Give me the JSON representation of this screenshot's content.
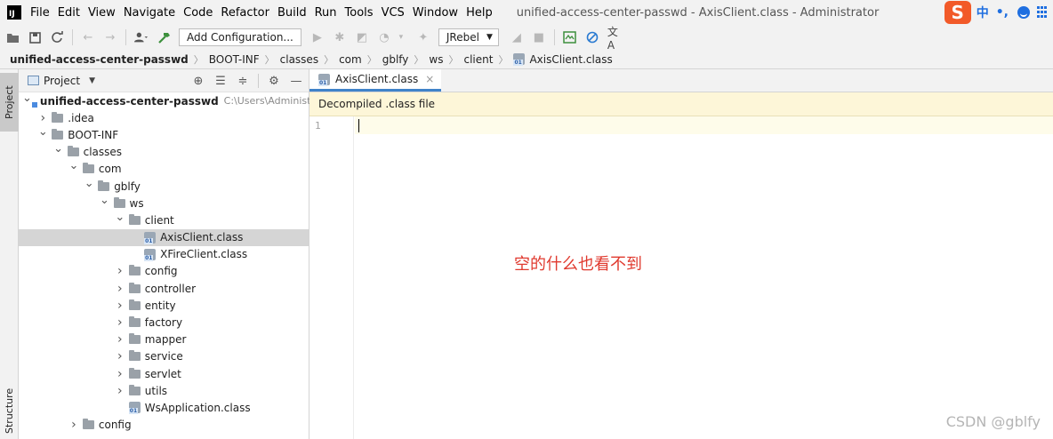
{
  "menubar": {
    "logo_text": "IJ",
    "items": [
      "File",
      "Edit",
      "View",
      "Navigate",
      "Code",
      "Refactor",
      "Build",
      "Run",
      "Tools",
      "VCS",
      "Window",
      "Help"
    ],
    "window_title": "unified-access-center-passwd - AxisClient.class - Administrator"
  },
  "ime": {
    "logo": "S",
    "mode": "中",
    "punct": "•,"
  },
  "toolbar": {
    "add_configuration": "Add Configuration...",
    "jrebel": "JRebel",
    "icons": [
      "open-icon",
      "save-icon",
      "sync-icon",
      "back-icon",
      "forward-icon",
      "user-icon",
      "build-hammer-icon",
      "run-icon",
      "debug-icon",
      "coverage-icon",
      "profile-icon",
      "jrebel-run-icon",
      "jrebel-debug-icon",
      "stop-icon",
      "monitor-icon",
      "no-entry-icon",
      "translate-icon"
    ]
  },
  "breadcrumb": [
    "unified-access-center-passwd",
    "BOOT-INF",
    "classes",
    "com",
    "gblfy",
    "ws",
    "client",
    "AxisClient.class"
  ],
  "left_strip": {
    "project_tab": "Project",
    "structure_tab": "Structure"
  },
  "project_panel": {
    "title": "Project",
    "tree": [
      {
        "label": "unified-access-center-passwd",
        "path": "C:\\Users\\Administra",
        "depth": 0,
        "expanded": true,
        "icon": "module",
        "bold": true
      },
      {
        "label": ".idea",
        "depth": 1,
        "expanded": false,
        "icon": "folder"
      },
      {
        "label": "BOOT-INF",
        "depth": 1,
        "expanded": true,
        "icon": "folder"
      },
      {
        "label": "classes",
        "depth": 2,
        "expanded": true,
        "icon": "folder"
      },
      {
        "label": "com",
        "depth": 3,
        "expanded": true,
        "icon": "folder"
      },
      {
        "label": "gblfy",
        "depth": 4,
        "expanded": true,
        "icon": "folder"
      },
      {
        "label": "ws",
        "depth": 5,
        "expanded": true,
        "icon": "folder"
      },
      {
        "label": "client",
        "depth": 6,
        "expanded": true,
        "icon": "folder"
      },
      {
        "label": "AxisClient.class",
        "depth": 7,
        "icon": "class",
        "selected": true
      },
      {
        "label": "XFireClient.class",
        "depth": 7,
        "icon": "class"
      },
      {
        "label": "config",
        "depth": 6,
        "expanded": false,
        "icon": "folder"
      },
      {
        "label": "controller",
        "depth": 6,
        "expanded": false,
        "icon": "folder"
      },
      {
        "label": "entity",
        "depth": 6,
        "expanded": false,
        "icon": "folder"
      },
      {
        "label": "factory",
        "depth": 6,
        "expanded": false,
        "icon": "folder"
      },
      {
        "label": "mapper",
        "depth": 6,
        "expanded": false,
        "icon": "folder"
      },
      {
        "label": "service",
        "depth": 6,
        "expanded": false,
        "icon": "folder"
      },
      {
        "label": "servlet",
        "depth": 6,
        "expanded": false,
        "icon": "folder"
      },
      {
        "label": "utils",
        "depth": 6,
        "expanded": false,
        "icon": "folder"
      },
      {
        "label": "WsApplication.class",
        "depth": 6,
        "icon": "class"
      },
      {
        "label": "config",
        "depth": 3,
        "expanded": false,
        "icon": "folder"
      }
    ]
  },
  "editor": {
    "tab_label": "AxisClient.class",
    "notice": "Decompiled .class file",
    "line_number": "1",
    "annotation": "空的什么也看不到"
  },
  "watermark": "CSDN @gblfy"
}
